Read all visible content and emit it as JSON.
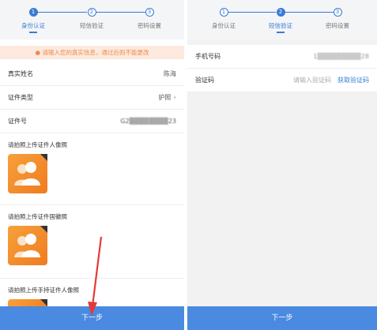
{
  "left": {
    "steps": [
      {
        "num": "1",
        "label": "身份认证",
        "active": true
      },
      {
        "num": "2",
        "label": "短信验证",
        "active": false
      },
      {
        "num": "3",
        "label": "密码设置",
        "active": false
      }
    ],
    "notice": "请输入您的真实信息，通过后则不能更改",
    "fields": [
      {
        "key": "真实姓名",
        "value": "陈海"
      },
      {
        "key": "证件类型",
        "value": "护照"
      },
      {
        "key": "证件号",
        "value": "G2▒▒▒▒▒▒▒▒23"
      }
    ],
    "uploads": [
      {
        "title": "请拍照上传证件人像照"
      },
      {
        "title": "请拍照上传证件国徽照"
      },
      {
        "title": "请拍照上传手持证件人像照"
      }
    ],
    "next_label": "下一步"
  },
  "right": {
    "steps": [
      {
        "num": "1",
        "label": "身份认证",
        "active": false
      },
      {
        "num": "2",
        "label": "短信验证",
        "active": true
      },
      {
        "num": "3",
        "label": "密码设置",
        "active": false
      }
    ],
    "phone": {
      "key": "手机号码",
      "value": "1▒▒▒▒▒▒▒▒▒28"
    },
    "code": {
      "key": "验证码",
      "placeholder": "请输入验证码",
      "action": "获取验证码"
    },
    "next_label": "下一步"
  },
  "colors": {
    "accent": "#3a7bd5",
    "notice_text": "#f08a4b",
    "notice_bg": "#fde9de",
    "button": "#4a8ae0",
    "annotation": "#e53935"
  }
}
